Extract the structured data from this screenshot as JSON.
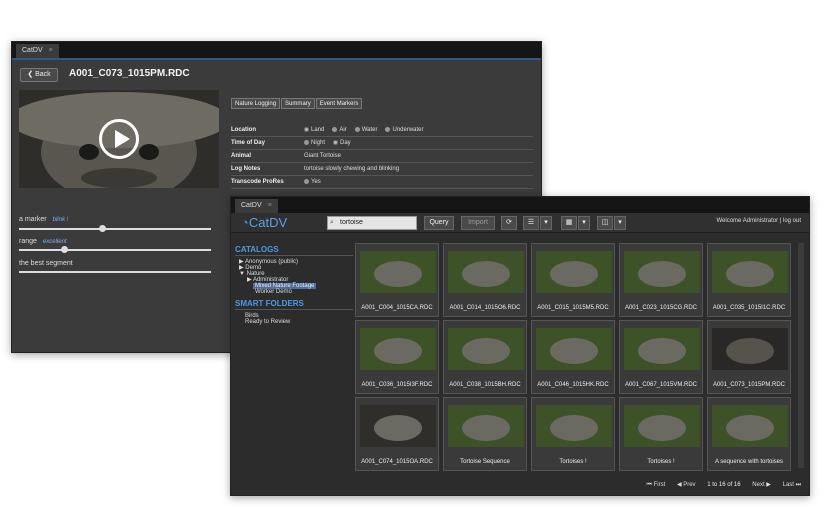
{
  "detail": {
    "tab": "CatDV",
    "back_label": "Back",
    "clip_title": "A001_C073_1015PM.RDC",
    "markers": [
      {
        "name": "a marker",
        "tag": "blink !",
        "position": 0.42
      },
      {
        "name": "range",
        "tag": "excellent",
        "position": 0.22
      },
      {
        "name": "the best segment",
        "tag": "",
        "position": null
      }
    ],
    "tabs": [
      "Nature Logging",
      "Summary",
      "Event Markers"
    ],
    "fields": {
      "location": {
        "label": "Location",
        "options": [
          "Land",
          "Air",
          "Water",
          "Underwater"
        ],
        "selected": "Land"
      },
      "time_of_day": {
        "label": "Time of Day",
        "options": [
          "Night",
          "Day"
        ],
        "selected": "Day"
      },
      "animal": {
        "label": "Animal",
        "value": "Giant Tortoise"
      },
      "log_notes": {
        "label": "Log Notes",
        "value": "tortoise slowly chewing and blinking"
      },
      "transcode": {
        "label": "Transcode ProRes",
        "option": "Yes"
      }
    }
  },
  "browser": {
    "tab": "CatDV",
    "logo": "CatDV",
    "search_value": "tortoise",
    "query_label": "Query",
    "import_label": "Import",
    "welcome": "Welcome Administrator",
    "logout": "log out",
    "catalogs_heading": "CATALOGS",
    "catalogs": [
      {
        "label": "Anonymous (public)",
        "arrow": "▶",
        "indent": 0
      },
      {
        "label": "Demo",
        "arrow": "▶",
        "indent": 0
      },
      {
        "label": "Nature",
        "arrow": "▼",
        "indent": 0
      },
      {
        "label": "Administrator",
        "arrow": "▶",
        "indent": 1
      },
      {
        "label": "Mixed Nature Footage",
        "arrow": "",
        "indent": 2,
        "selected": true
      },
      {
        "label": "Worker Demo",
        "arrow": "",
        "indent": 2
      }
    ],
    "smart_heading": "SMART FOLDERS",
    "smart_folders": [
      "Birds",
      "Ready to Review"
    ],
    "clips": [
      "A001_C004_1015CA.RDC",
      "A001_C014_1015O6.RDC",
      "A001_C015_1015M5.RDC",
      "A001_C023_1015CG.RDC",
      "A001_C035_1015I1C.RDC",
      "A001_C036_1015I3F.RDC",
      "A001_C038_1015BH.RDC",
      "A001_C046_1015HK.RDC",
      "A001_C067_1015VM.RDC",
      "A001_C073_1015PM.RDC",
      "A001_C074_1015OA.RDC",
      "Tortoise Sequence",
      "Tortoises !",
      "Tortoises !",
      "A sequence with tortoises"
    ],
    "pager": {
      "first": "First",
      "prev": "Prev",
      "count": "1 to 16 of 16",
      "next": "Next",
      "last": "Last"
    }
  }
}
